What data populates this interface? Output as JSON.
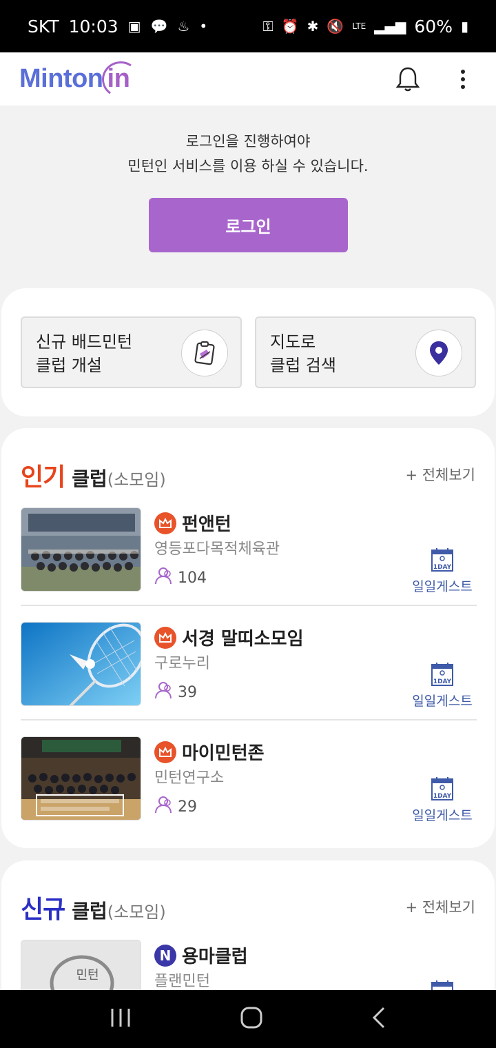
{
  "status_bar": {
    "carrier": "SKT",
    "time": "10:03",
    "network": "LTE",
    "battery": "60%",
    "icons": [
      "gallery-icon",
      "talk-icon",
      "notification-icon",
      "dot-icon",
      "key-icon",
      "alarm-icon",
      "bluetooth-icon",
      "mute-icon",
      "signal-icon",
      "battery-icon"
    ]
  },
  "header": {
    "logo_text_main": "Minton",
    "logo_text_accent": "in",
    "icons": [
      "bell-icon",
      "more-vert-icon"
    ]
  },
  "login": {
    "message_line1": "로그인을 진행하여야",
    "message_line2": "민턴인 서비스를 이용 하실 수 있습니다.",
    "button_label": "로그인"
  },
  "quick_actions": [
    {
      "line1": "신규 배드민턴",
      "line2": "클럽 개설",
      "icon": "clipboard-shuttle-icon"
    },
    {
      "line1": "지도로",
      "line2": "클럽 검색",
      "icon": "map-pin-icon"
    }
  ],
  "popular": {
    "highlight": "인기",
    "title": "클럽",
    "subtitle": "(소모임)",
    "view_all": "+ 전체보기",
    "highlight_color": "#e8441c",
    "clubs": [
      {
        "name": "펀앤턴",
        "location": "영등포다목적체육관",
        "members": "104",
        "badge": "일일게스트"
      },
      {
        "name": "서경 말띠소모임",
        "location": "구로누리",
        "members": "39",
        "badge": "일일게스트"
      },
      {
        "name": "마이민턴존",
        "location": "민턴연구소",
        "members": "29",
        "badge": "일일게스트"
      }
    ]
  },
  "new_clubs": {
    "highlight": "신규",
    "title": "클럽",
    "subtitle": "(소모임)",
    "view_all": "+ 전체보기",
    "highlight_color": "#2a2fc4",
    "clubs": [
      {
        "name": "용마클럽",
        "location": "플랜민턴",
        "thumb_text": "민턴"
      }
    ]
  },
  "oneday_icon_text": "1DAY",
  "colors": {
    "accent": "#a866cc",
    "brand_blue": "#5b6fd8",
    "guest_blue": "#3e5aa8"
  },
  "nav_bar": {
    "icons": [
      "recent-apps-icon",
      "home-icon",
      "back-icon"
    ]
  }
}
